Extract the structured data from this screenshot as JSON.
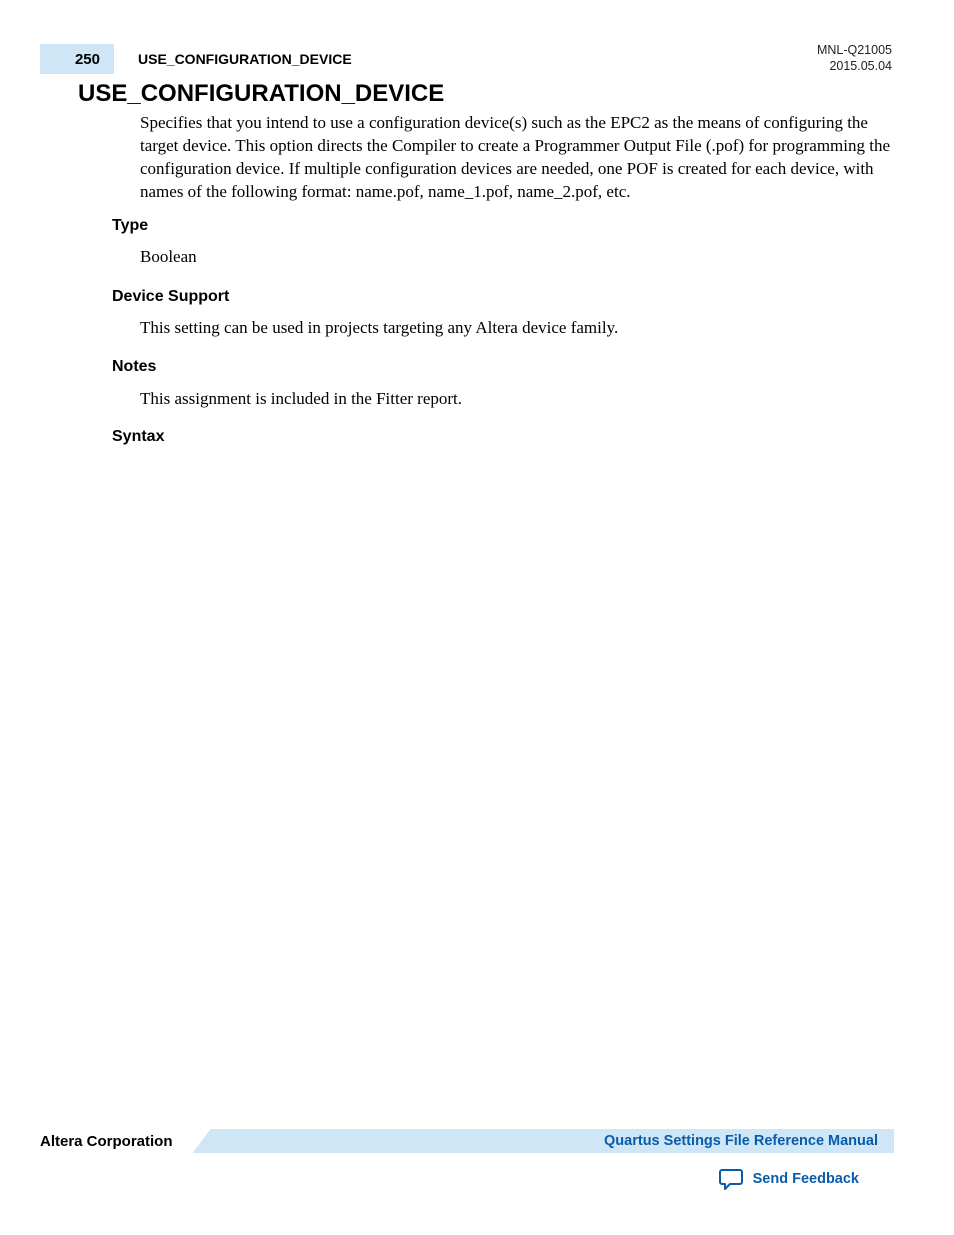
{
  "header": {
    "page_number": "250",
    "running_title": "USE_CONFIGURATION_DEVICE",
    "doc_id": "MNL-Q21005",
    "date": "2015.05.04"
  },
  "title": "USE_CONFIGURATION_DEVICE",
  "intro": "Specifies that you intend to use a configuration device(s) such as the EPC2 as the means of configuring the target device. This option directs the Compiler to create a Programmer Output File (.pof) for programming the configuration device. If multiple configuration devices are needed, one POF is created for each device, with names of the following format: name.pof, name_1.pof, name_2.pof, etc.",
  "sections": {
    "type": {
      "label": "Type",
      "body": "Boolean"
    },
    "device_support": {
      "label": "Device Support",
      "body": "This setting can be used in projects targeting any Altera device family."
    },
    "notes": {
      "label": "Notes",
      "body": "This assignment is included in the Fitter report."
    },
    "syntax": {
      "label": "Syntax"
    }
  },
  "footer": {
    "company": "Altera Corporation",
    "manual_title": "Quartus Settings File Reference Manual",
    "send_feedback": "Send Feedback"
  }
}
